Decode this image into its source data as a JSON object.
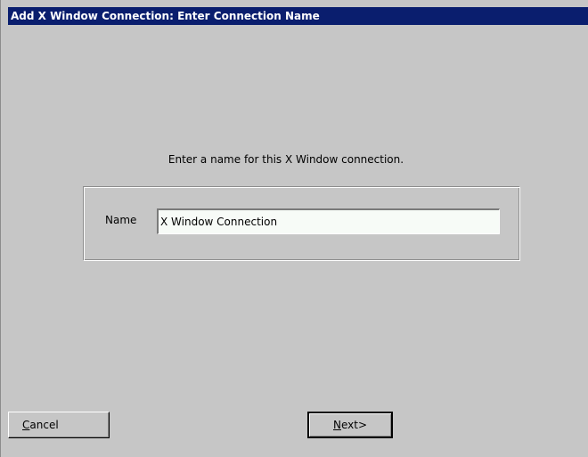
{
  "window": {
    "title": "Add X Window Connection: Enter Connection Name"
  },
  "prompt": "Enter a name for this X Window connection.",
  "form": {
    "name_label": "Name",
    "name_value": "X Window Connection"
  },
  "buttons": {
    "cancel_mnemonic": "C",
    "cancel_rest": "ancel",
    "next_mnemonic": "N",
    "next_rest": "ext>"
  },
  "colors": {
    "titlebar": "#0a1e6e",
    "background": "#c6c6c6"
  }
}
